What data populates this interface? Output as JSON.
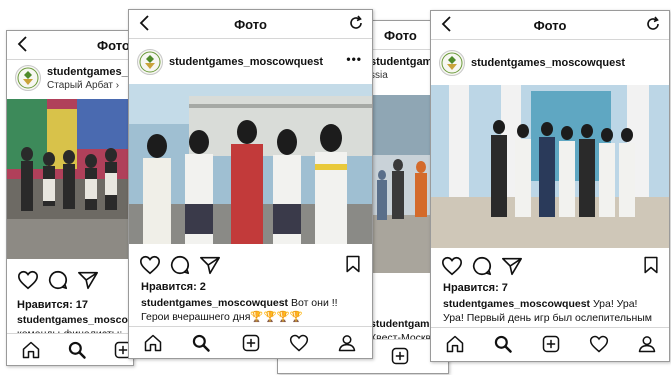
{
  "screens": [
    {
      "title": "Фото",
      "username": "studentgames_m",
      "location": "Старый Арбат",
      "likes": "Нравится: 17",
      "caption_user": "studentgames_moscowquest",
      "caption_line2": "команды-финалисты:"
    },
    {
      "title": "Фото",
      "username": "studentgames_moscowquest",
      "location": "",
      "likes": "Нравится: 2",
      "caption_user": "studentgames_moscowquest",
      "caption_text": " Вот они !!",
      "caption_line2": "Герои вчерашнего дня🏆🏆🏆🏆"
    },
    {
      "title": "Фото",
      "username": "studentgames_mo",
      "location": "ssia",
      "caption_user": "studentgames_moscowq",
      "caption_line2": "Квест-Москва"
    },
    {
      "title": "Фото",
      "username": "studentgames_moscowquest",
      "location": "",
      "likes": "Нравится: 7",
      "caption_user": "studentgames_moscowquest",
      "caption_text": " Ура! Ура!",
      "caption_line2": "Ура! Первый день игр был ослепительным"
    }
  ],
  "icons": [
    "back-arrow-icon",
    "refresh-icon",
    "more-icon",
    "heart-icon",
    "comment-icon",
    "share-icon",
    "bookmark-icon",
    "home-icon",
    "search-icon",
    "add-icon",
    "activity-icon",
    "profile-icon"
  ],
  "colors": {
    "separator": "#d6d6d6",
    "frame": "#9a9a9a",
    "text": "#111111"
  }
}
